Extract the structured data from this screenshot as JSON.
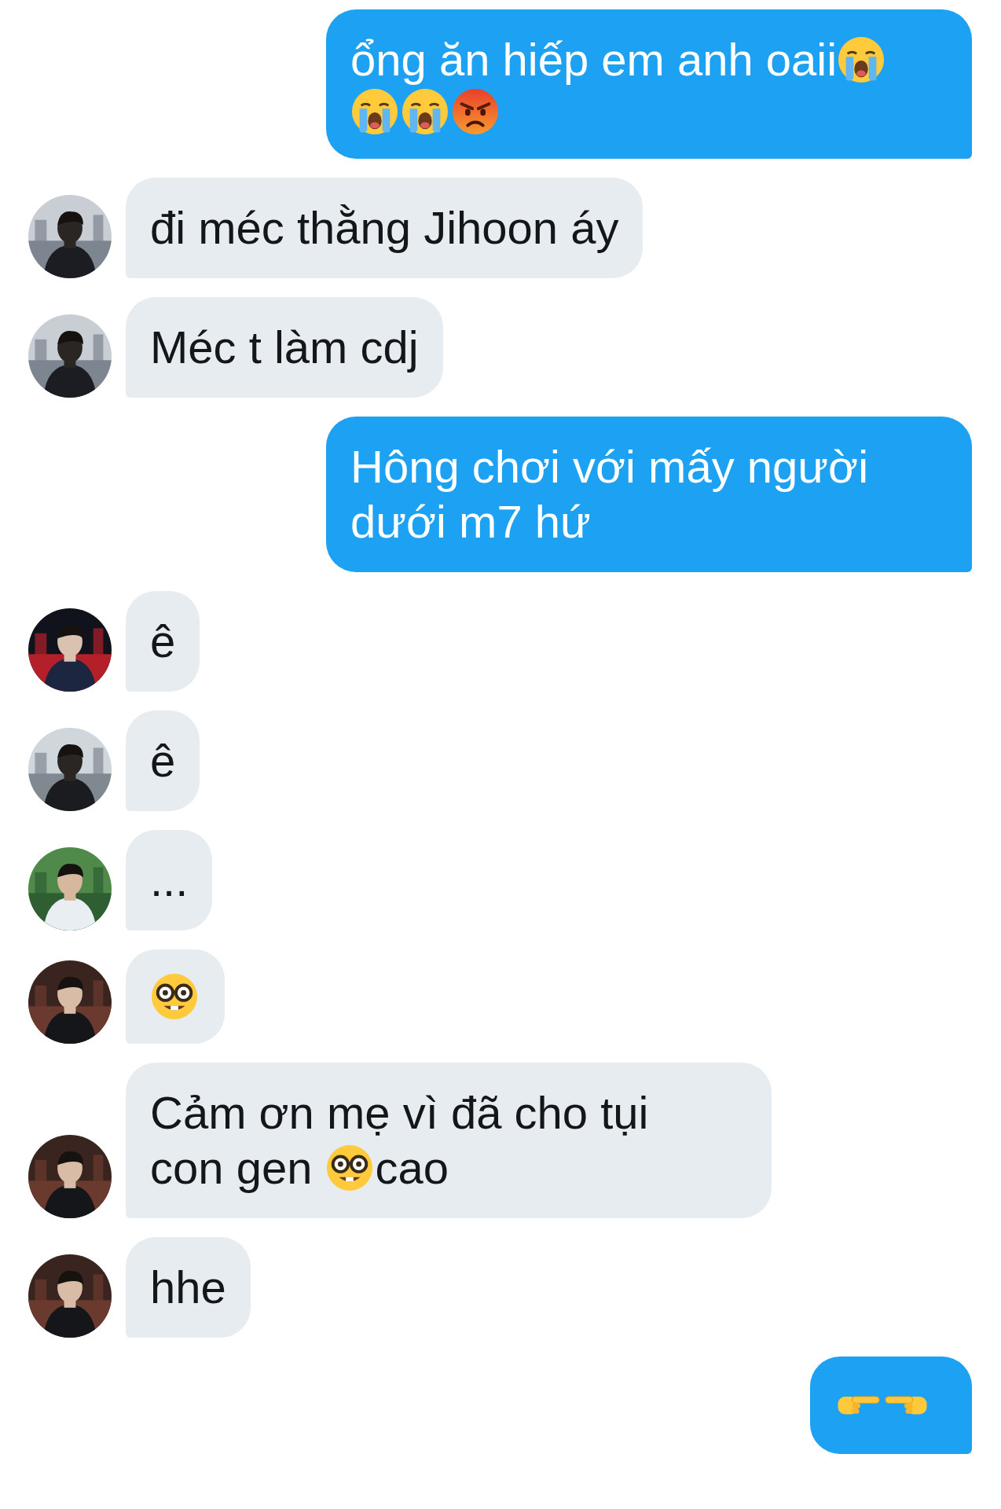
{
  "messages": [
    {
      "kind": "sent",
      "parts": [
        {
          "kind": "text",
          "text": "ổng ăn hiếp em anh oaii"
        },
        {
          "kind": "crying"
        },
        {
          "kind": "crying"
        },
        {
          "kind": "crying"
        },
        {
          "kind": "angry"
        }
      ]
    },
    {
      "kind": "received",
      "avatar": {
        "kind": "picture"
      },
      "parts": [
        {
          "kind": "text",
          "text": "đi méc thằng Jihoon áy"
        }
      ]
    },
    {
      "kind": "received",
      "avatar": {
        "kind": "picture"
      },
      "parts": [
        {
          "kind": "text",
          "text": "Méc t làm cdj"
        }
      ]
    },
    {
      "kind": "sent",
      "parts": [
        {
          "kind": "text",
          "text": "Hông chơi với mấy người dưới m7 hứ"
        }
      ]
    },
    {
      "kind": "received",
      "avatar": {
        "kind": "picture"
      },
      "parts": [
        {
          "kind": "text",
          "text": "ê"
        }
      ]
    },
    {
      "kind": "received",
      "avatar": {
        "kind": "picture"
      },
      "parts": [
        {
          "kind": "text",
          "text": "ê"
        }
      ]
    },
    {
      "kind": "received",
      "avatar": {
        "kind": "picture"
      },
      "parts": [
        {
          "kind": "text",
          "text": "..."
        }
      ]
    },
    {
      "kind": "received",
      "avatar": {
        "kind": "picture"
      },
      "parts": [
        {
          "kind": "nerd"
        }
      ]
    },
    {
      "kind": "received",
      "avatar": {
        "kind": "picture"
      },
      "parts": [
        {
          "kind": "text",
          "text": "Cảm ơn mẹ vì đã cho tụi"
        },
        {
          "kind": "text",
          "text": "con gen "
        },
        {
          "kind": "nerd"
        },
        {
          "kind": "text",
          "text": "cao"
        }
      ]
    },
    {
      "kind": "received",
      "avatar": {
        "kind": "picture"
      },
      "parts": [
        {
          "kind": "text",
          "text": "hhe"
        }
      ]
    },
    {
      "kind": "sent",
      "parts": [
        {
          "kind": "pointright"
        },
        {
          "kind": "pointleft"
        }
      ]
    }
  ]
}
